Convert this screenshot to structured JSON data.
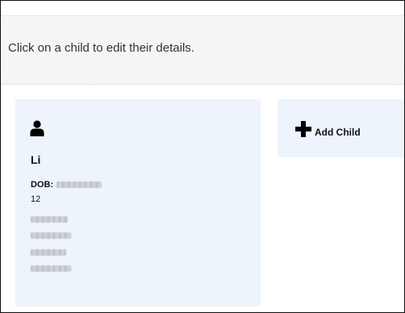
{
  "info_bar": {
    "message": "Click on a child to edit their details."
  },
  "children": [
    {
      "icon": "user-icon",
      "name": "Li",
      "dob_label": "DOB:",
      "age": "12"
    }
  ],
  "add_child": {
    "icon": "plus-icon",
    "label": "Add Child"
  },
  "colors": {
    "card_background": "#edf4fc",
    "info_bar_background": "#f4f4f4",
    "text": "#111111"
  }
}
